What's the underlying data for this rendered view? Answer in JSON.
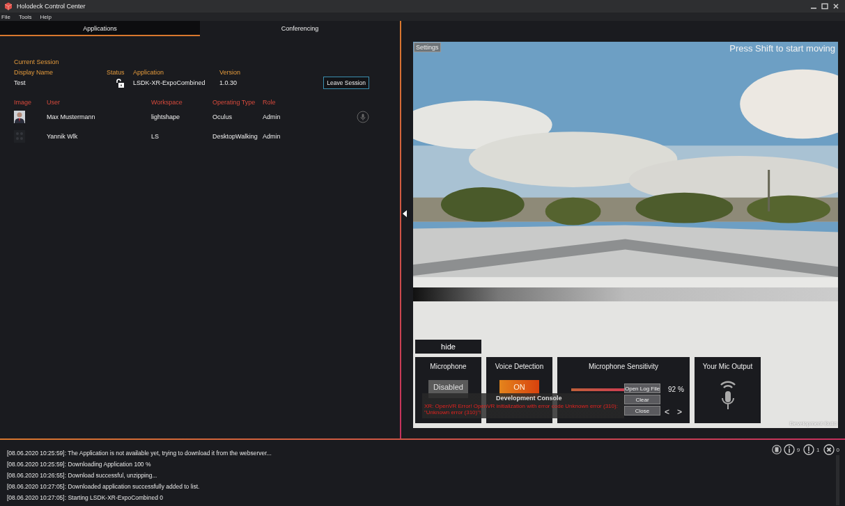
{
  "window": {
    "title": "Holodeck Control Center"
  },
  "menu": [
    "File",
    "Tools",
    "Help"
  ],
  "tabs": [
    {
      "label": "Applications",
      "selected": true
    },
    {
      "label": "Conferencing",
      "selected": false
    }
  ],
  "session": {
    "heading": "Current Session",
    "columns": [
      "Display Name",
      "Status",
      "Application",
      "Version"
    ],
    "display_name": "Test",
    "locked": false,
    "application": "LSDK-XR-ExpoCombined",
    "version": "1.0.30",
    "leave_button": "Leave Session"
  },
  "users": {
    "columns": [
      "Image",
      "User",
      "Workspace",
      "Operating Type",
      "Role"
    ],
    "rows": [
      {
        "user": "Max Mustermann",
        "workspace": "lightshape",
        "operating_type": "Oculus",
        "role": "Admin",
        "mic": true
      },
      {
        "kind": "pattern",
        "user": "Yannik Wlk",
        "workspace": "LS",
        "operating_type": "DesktopWalking",
        "role": "Admin",
        "mic": false
      }
    ]
  },
  "viewer": {
    "settings_button": "Settings",
    "hint": "Press Shift to start moving",
    "hide_button": "hide",
    "build_label": "Development Build",
    "cards": [
      {
        "kind": "toggle",
        "title": "Microphone",
        "value": "Disabled",
        "on": false
      },
      {
        "kind": "toggle",
        "title": "Voice Detection",
        "value": "ON",
        "on": true
      },
      {
        "kind": "slider",
        "title": "Microphone Sensitivity",
        "level": 0.92,
        "reading": "92 %"
      },
      {
        "kind": "output",
        "title": "Your Mic Output"
      }
    ],
    "console": {
      "title": "Development Console",
      "error": "XR: OpenVR Error! OpenVR initialization with error code Unknown error (310): \"Unknown error (310)\"!",
      "buttons": [
        "Open Log File",
        "Clear",
        "Close"
      ],
      "prev": "<",
      "next": ">"
    }
  },
  "log": [
    "[08.06.2020 10:25:59]: The Application is not available yet, trying to download it from the webserver...",
    "[08.06.2020 10:25:59]: Downloading Application 100 %",
    "[08.06.2020 10:26:55]: Download successful, unzipping...",
    "[08.06.2020 10:27:05]: Downloaded application successfully added to list.",
    "[08.06.2020 10:27:05]: Starting LSDK-XR-ExpoCombined 0"
  ],
  "counters": [
    {
      "kind": "info",
      "count": "9"
    },
    {
      "kind": "warning",
      "count": "1"
    },
    {
      "kind": "error",
      "count": "0"
    }
  ]
}
